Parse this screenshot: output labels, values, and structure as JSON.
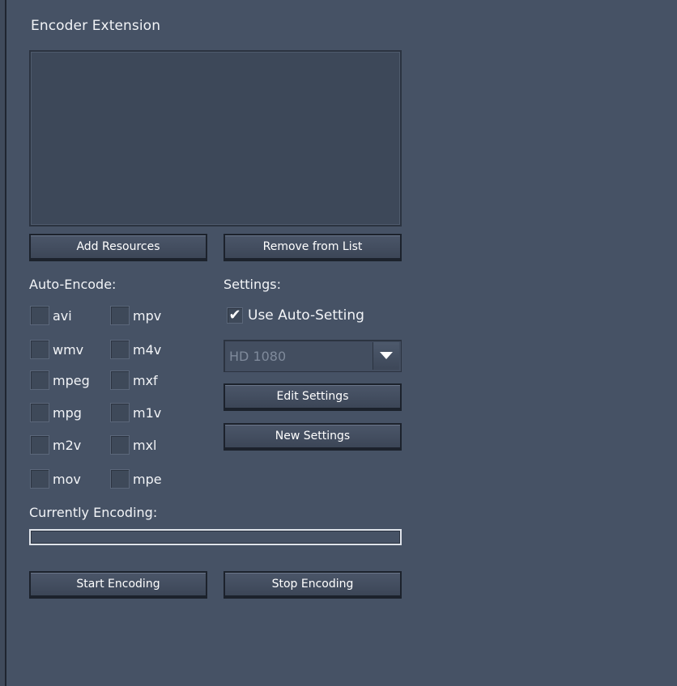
{
  "panel": {
    "title": "Encoder Extension"
  },
  "resources": {
    "add_label": "Add Resources",
    "remove_label": "Remove from List"
  },
  "auto_encode": {
    "label": "Auto-Encode:",
    "left_column": [
      {
        "label": "avi",
        "checked": false
      },
      {
        "label": "wmv",
        "checked": false
      },
      {
        "label": "mpeg",
        "checked": false
      },
      {
        "label": "mpg",
        "checked": false
      },
      {
        "label": "m2v",
        "checked": false
      },
      {
        "label": "mov",
        "checked": false
      }
    ],
    "right_column": [
      {
        "label": "mpv",
        "checked": false
      },
      {
        "label": "m4v",
        "checked": false
      },
      {
        "label": "mxf",
        "checked": false
      },
      {
        "label": "m1v",
        "checked": false
      },
      {
        "label": "mxl",
        "checked": false
      },
      {
        "label": "mpe",
        "checked": false
      }
    ]
  },
  "settings": {
    "label": "Settings:",
    "use_auto_label": "Use Auto-Setting",
    "use_auto_checked": true,
    "preset_value": "HD 1080",
    "edit_label": "Edit Settings",
    "new_label": "New Settings"
  },
  "encoding": {
    "label": "Currently Encoding:",
    "progress": 0,
    "start_label": "Start Encoding",
    "stop_label": "Stop Encoding"
  },
  "icons": {
    "checkmark": "check-icon",
    "dropdown": "triangle-down-icon"
  }
}
